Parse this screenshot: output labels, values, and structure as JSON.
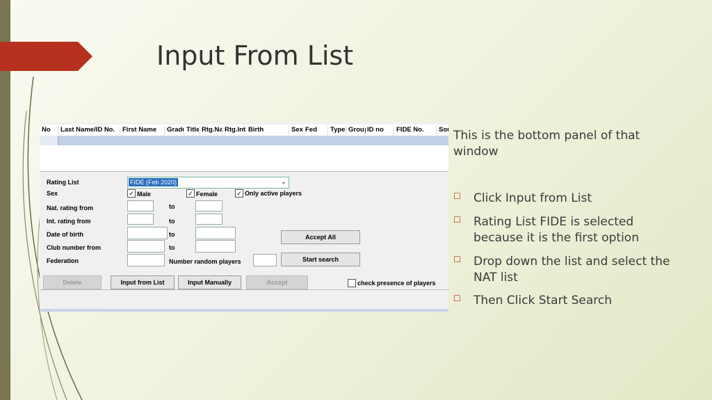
{
  "slide": {
    "title": "Input From List",
    "intro": "This is the bottom panel of that window",
    "bullets": [
      "Click Input from List",
      "Rating List FIDE is selected because it is the first option",
      "Drop down the list and select the NAT list",
      "Then Click Start Search"
    ],
    "bullet_marker": "☐",
    "accent_color": "#b5311e"
  },
  "panel": {
    "columns": [
      "No",
      "Last Name/ID No.",
      "First Name",
      "Gradu",
      "Title",
      "Rtg.Nat",
      "Rtg.Int",
      "Birth",
      "Sex",
      "Fed",
      "Type",
      "Group",
      "ID no",
      "FIDE No.",
      "Sou"
    ],
    "rating_list_label": "Rating List",
    "rating_list_value": "FIDE (Feb 2020)",
    "sex_label": "Sex",
    "male_label": "Male",
    "female_label": "Female",
    "only_active_label": "Only active players",
    "nat_rating_label": "Nat. rating from",
    "int_rating_label": "Int. rating from",
    "dob_label": "Date of birth",
    "club_label": "Club number from",
    "federation_label": "Federation",
    "to_label": "to",
    "random_label": "Number random players",
    "accept_all": "Accept All",
    "start_search": "Start search",
    "delete": "Delete",
    "input_from_list": "Input from List",
    "input_manually": "Input Manually",
    "accept": "Accept",
    "check_presence": "check presence of players"
  }
}
